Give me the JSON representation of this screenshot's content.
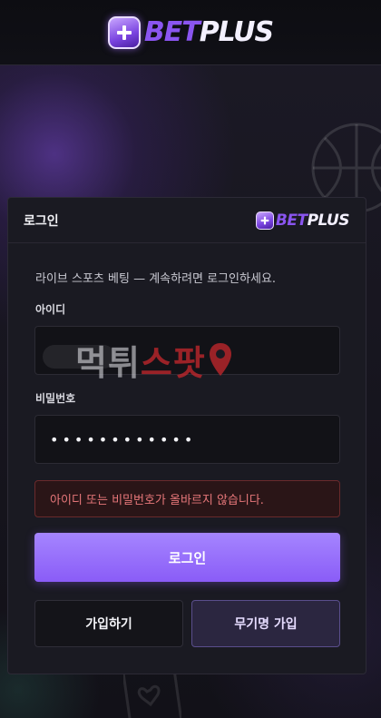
{
  "header": {
    "logo_bet": "BET",
    "logo_plus": "PLUS"
  },
  "panel": {
    "title": "로그인",
    "logo_bet": "BET",
    "logo_plus": "PLUS",
    "intro": "라이브 스포츠 베팅 — 계속하려면 로그인하세요.",
    "id_label": "아이디",
    "id_value": "",
    "password_label": "비밀번호",
    "password_value": "••••••••••••",
    "error": "아이디 또는 비밀번호가 올바르지 않습니다.",
    "login_button": "로그인",
    "signup_button": "가입하기",
    "anon_signup_button": "무기명 가입"
  },
  "watermark": {
    "part1": "먹튀",
    "part2": "스팟"
  },
  "colors": {
    "accent": "#8a5cf7",
    "error_text": "#e7777a",
    "background": "#14131a"
  }
}
